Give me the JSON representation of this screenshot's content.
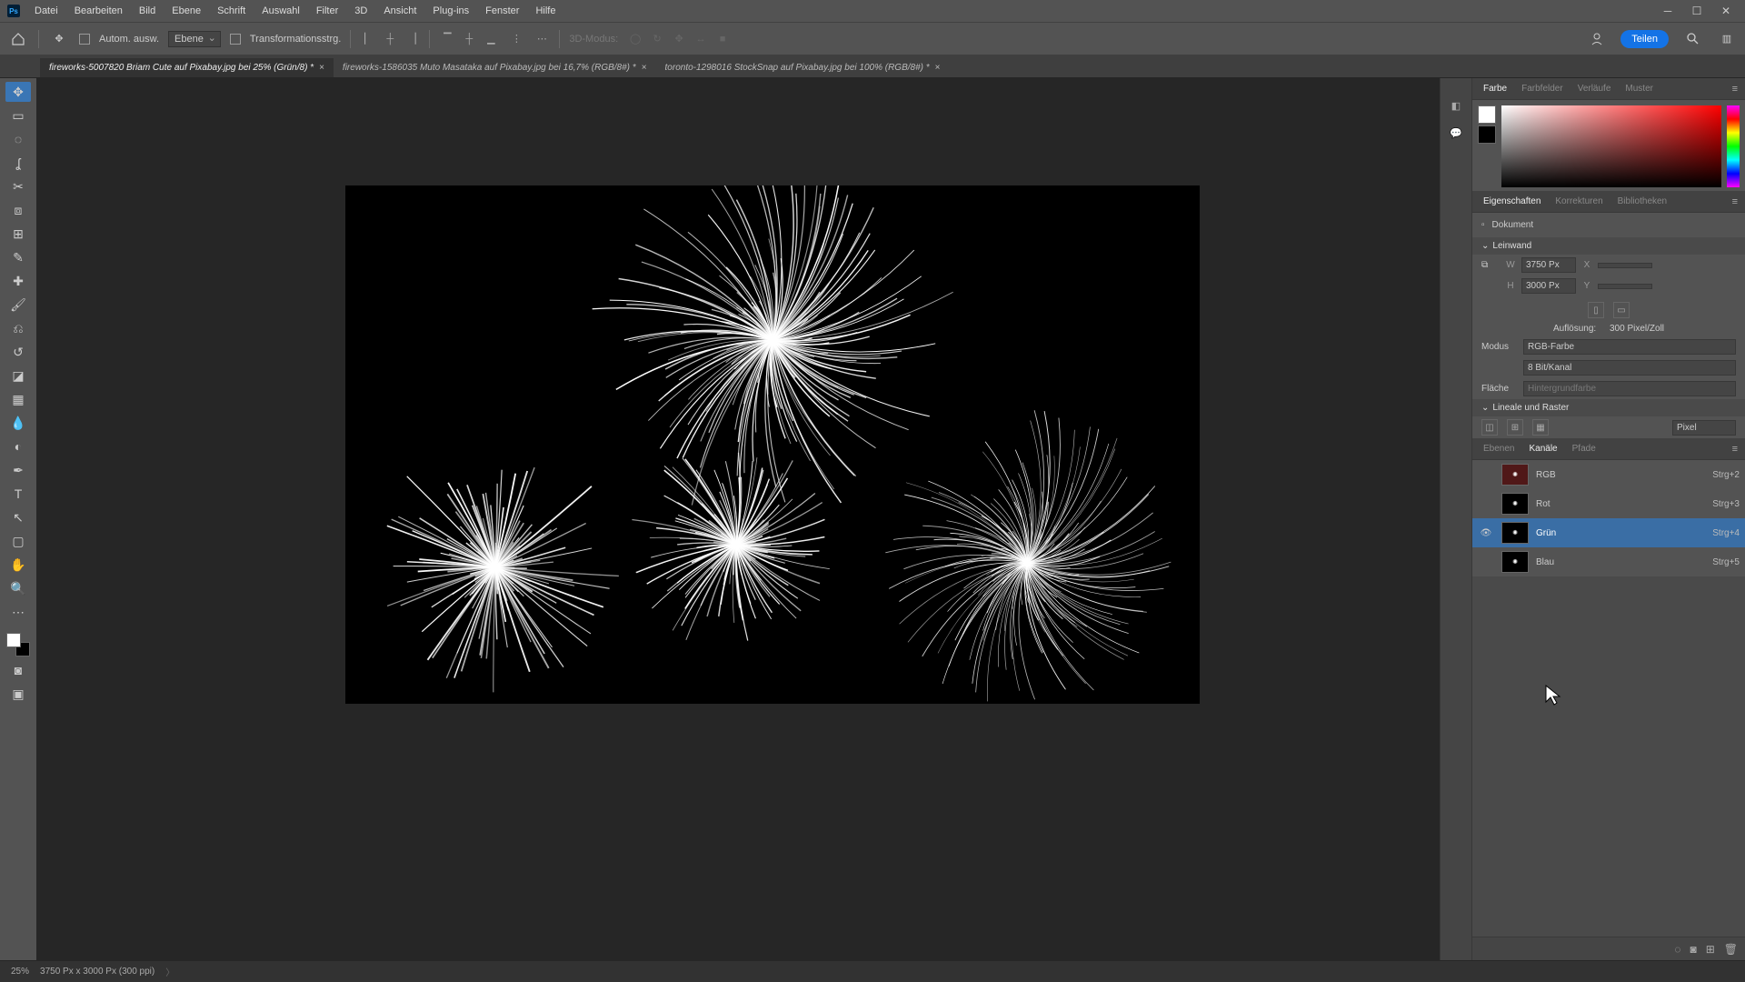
{
  "menu": {
    "items": [
      "Datei",
      "Bearbeiten",
      "Bild",
      "Ebene",
      "Schrift",
      "Auswahl",
      "Filter",
      "3D",
      "Ansicht",
      "Plug-ins",
      "Fenster",
      "Hilfe"
    ]
  },
  "options": {
    "auto_select": "Autom. ausw.",
    "target_select": "Ebene",
    "transform": "Transformationsstrg.",
    "mode3d": "3D-Modus:",
    "share": "Teilen"
  },
  "tabs": [
    {
      "label": "fireworks-5007820 Briam Cute auf Pixabay.jpg bei 25% (Grün/8) *",
      "active": true
    },
    {
      "label": "fireworks-1586035 Muto Masataka auf Pixabay.jpg bei 16,7% (RGB/8#) *",
      "active": false
    },
    {
      "label": "toronto-1298016 StockSnap auf Pixabay.jpg bei 100% (RGB/8#) *",
      "active": false
    }
  ],
  "color_panel": {
    "tabs": [
      "Farbe",
      "Farbfelder",
      "Verläufe",
      "Muster"
    ],
    "active": 0,
    "fg": "#ffffff",
    "bg": "#000000"
  },
  "props_panel": {
    "tabs": [
      "Eigenschaften",
      "Korrekturen",
      "Bibliotheken"
    ],
    "active": 0,
    "doc_label": "Dokument",
    "section_canvas": "Leinwand",
    "w_label": "W",
    "w_value": "3750 Px",
    "h_label": "H",
    "h_value": "3000 Px",
    "x_label": "X",
    "x_value": "",
    "y_label": "Y",
    "y_value": "",
    "resolution_label": "Auflösung:",
    "resolution_value": "300 Pixel/Zoll",
    "mode_label": "Modus",
    "mode_value": "RGB-Farbe",
    "depth_value": "8 Bit/Kanal",
    "fill_label": "Fläche",
    "fill_value": "Hintergrundfarbe",
    "section_rulers": "Lineale und Raster",
    "units": "Pixel"
  },
  "channels_panel": {
    "tabs": [
      "Ebenen",
      "Kanäle",
      "Pfade"
    ],
    "active": 1,
    "rows": [
      {
        "name": "RGB",
        "shortcut": "Strg+2",
        "visible": false,
        "selected": false,
        "color": "#803030"
      },
      {
        "name": "Rot",
        "shortcut": "Strg+3",
        "visible": false,
        "selected": false,
        "color": "#222"
      },
      {
        "name": "Grün",
        "shortcut": "Strg+4",
        "visible": true,
        "selected": true,
        "color": "#222"
      },
      {
        "name": "Blau",
        "shortcut": "Strg+5",
        "visible": false,
        "selected": false,
        "color": "#222"
      }
    ]
  },
  "status": {
    "zoom": "25%",
    "doc_info": "3750 Px x 3000 Px (300 ppi)"
  },
  "tools": [
    "move",
    "artboard",
    "marquee",
    "lasso",
    "wand",
    "crop",
    "frame",
    "eyedropper",
    "heal",
    "brush",
    "stamp",
    "history",
    "eraser",
    "gradient",
    "blur",
    "dodge",
    "pen",
    "type",
    "path",
    "rect",
    "hand",
    "zoom"
  ]
}
